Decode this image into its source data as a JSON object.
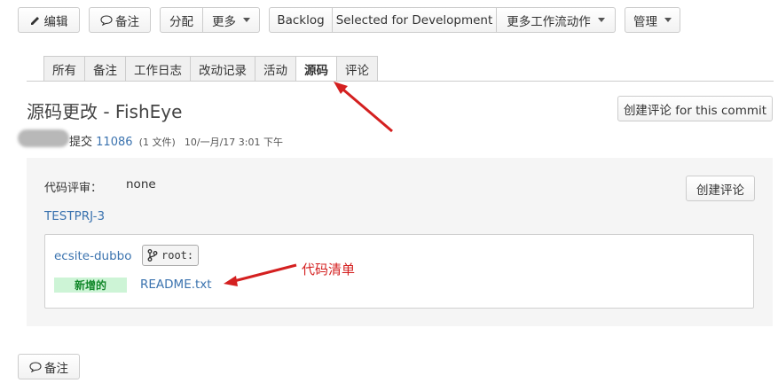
{
  "toolbar": {
    "edit_label": "编辑",
    "comment_label": "备注",
    "assign_label": "分配",
    "more_label": "更多",
    "backlog_label": "Backlog",
    "selected_label": "Selected for Development",
    "workflow_label": "更多工作流动作",
    "admin_label": "管理"
  },
  "tabs": [
    {
      "label": "所有"
    },
    {
      "label": "备注"
    },
    {
      "label": "工作日志"
    },
    {
      "label": "改动记录"
    },
    {
      "label": "活动"
    },
    {
      "label": "源码"
    },
    {
      "label": "评论"
    }
  ],
  "source": {
    "title": "源码更改 - FishEye",
    "create_review_commit_label": "创建评论 for this commit",
    "commit_prefix": "提交",
    "commit_id": "11086",
    "file_count": "(1 文件)",
    "date": "10/一月/17 3:01 下午"
  },
  "panel": {
    "review_label": "代码评审：",
    "review_value": "none",
    "create_review_label": "创建评论",
    "issue_key": "TESTPRJ-3",
    "repo": "ecsite-dubbo",
    "branch": "root:",
    "badge": "新增的",
    "file": "README.txt"
  },
  "annotation": {
    "text": "代码清单",
    "color": "#d42020"
  },
  "footer": {
    "comment_label": "备注"
  },
  "colors": {
    "link": "#3b73af",
    "badge_bg": "#cdf4d6",
    "badge_text": "#14892c"
  }
}
